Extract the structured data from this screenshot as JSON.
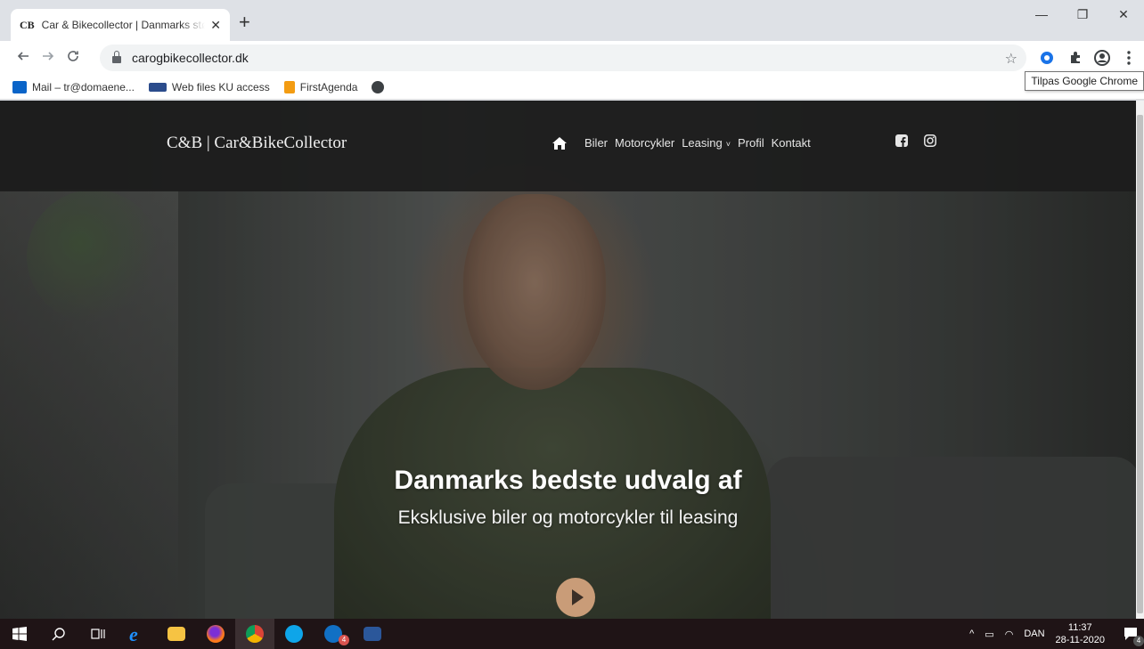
{
  "browser": {
    "tab": {
      "favicon": "CB",
      "title": "Car & Bikecollector | Danmarks største",
      "close": "✕"
    },
    "new_tab": "+",
    "window_controls": {
      "minimize": "—",
      "restore": "❐",
      "close": "✕"
    },
    "address": {
      "url": "carogbikecollector.dk"
    },
    "bookmarks": [
      {
        "label": "Mail – tr@domaene..."
      },
      {
        "label": "Web files KU access"
      },
      {
        "label": "FirstAgenda"
      }
    ],
    "tooltip": "Tilpas Google Chrome"
  },
  "site": {
    "logo": "C&B | Car&BikeCollector",
    "nav": [
      {
        "label": "Biler"
      },
      {
        "label": "Motorcykler"
      },
      {
        "label": "Leasing"
      },
      {
        "label": "Profil"
      },
      {
        "label": "Kontakt"
      }
    ],
    "leasing_caret": "˅",
    "hero": {
      "title": "Danmarks bedste udvalg af",
      "subtitle": "Eksklusive biler og motorcykler til leasing"
    }
  },
  "taskbar": {
    "language": "DAN",
    "time": "11:37",
    "date": "28-11-2020",
    "skype_badge": "4",
    "notification_badge": "4"
  },
  "colors": {
    "header_bg": "#1c1c1c",
    "play_button": "#c99c78",
    "taskbar_bg": "#1f1416"
  }
}
